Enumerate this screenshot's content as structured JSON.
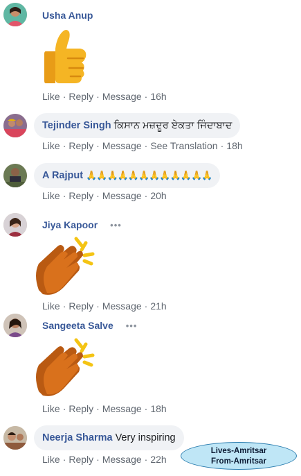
{
  "actions": {
    "like": "Like",
    "reply": "Reply",
    "message": "Message",
    "see_translation": "See Translation",
    "separator": "·"
  },
  "comments": [
    {
      "name": "Usha Anup",
      "text": "",
      "sticker": "thumbs-up",
      "time": "16h"
    },
    {
      "name": "Tejinder Singh",
      "text": "ਕਿਸਾਨ ਮਜ਼ਦੂਰ ਏਕਤਾ ਜਿੰਦਾਬਾਦ",
      "time": "18h"
    },
    {
      "name": "A Rajput",
      "text": "🙏🙏🙏🙏🙏🙏🙏🙏🙏🙏🙏🙏",
      "time": "20h"
    },
    {
      "name": "Jiya Kapoor",
      "text": "",
      "more": "•••",
      "sticker": "clapping-hands",
      "time": "21h"
    },
    {
      "name": "Sangeeta Salve",
      "text": "",
      "more": "•••",
      "sticker": "clapping-hands",
      "time": "18h"
    },
    {
      "name": "Neerja Sharma",
      "text": "Very inspiring",
      "time": "22h"
    }
  ],
  "badge": {
    "line1": "Lives-Amritsar",
    "line2": "From-Amritsar"
  },
  "colors": {
    "name": "#385898",
    "meta": "#606770",
    "bubble": "#f0f2f5",
    "badge_fill": "#bfe6f6",
    "badge_border": "#2e7fb0"
  }
}
